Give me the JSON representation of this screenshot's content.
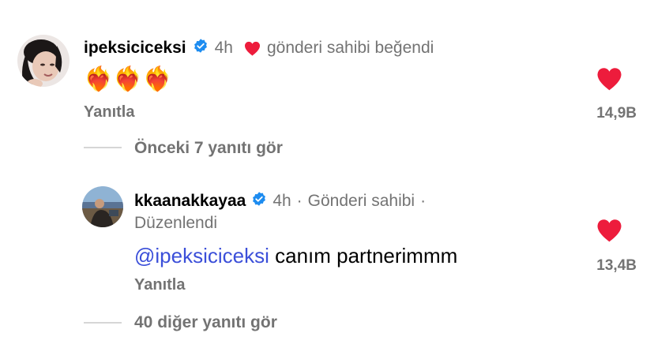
{
  "comment1": {
    "username": "ipeksiciceksi",
    "time": "4h",
    "liked_by_author_label": "gönderi sahibi beğendi",
    "text": "❤️‍🔥❤️‍🔥❤️‍🔥",
    "reply_label": "Yanıtla",
    "like_count": "14,9B"
  },
  "view_previous": {
    "label": "Önceki 7 yanıtı gör"
  },
  "comment2": {
    "username": "kkaanakkayaa",
    "time": "4h",
    "author_badge": "Gönderi sahibi",
    "separator": "·",
    "edited_label": "Düzenlendi",
    "mention": "@ipeksiciceksi",
    "text": " canım partnerimmm",
    "reply_label": "Yanıtla",
    "like_count": "13,4B"
  },
  "view_more": {
    "label": "40 diğer yanıtı gör"
  },
  "colors": {
    "heart": "#ed1c3c",
    "verified": "#1d8cf0",
    "meta": "#737373",
    "mention": "#3b4fd9"
  }
}
